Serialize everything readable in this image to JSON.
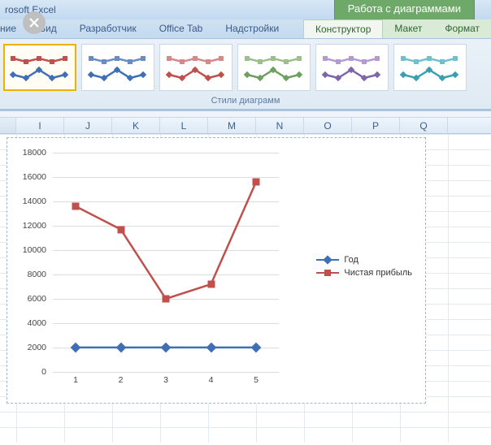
{
  "app": {
    "title": "rosoft Excel",
    "context_title": "Работа с диаграммами"
  },
  "tabs": {
    "partial_left": "ние",
    "items": [
      "Вид",
      "Разработчик",
      "Office Tab",
      "Надстройки"
    ],
    "context": [
      "Конструктор",
      "Макет",
      "Формат"
    ],
    "active_context_index": 0
  },
  "ribbon": {
    "group_label": "Стили диаграмм",
    "style_colors": [
      {
        "top": "#c0504d",
        "bot": "#3f6fb5"
      },
      {
        "top": "#6a8cc1",
        "bot": "#3f6fb5"
      },
      {
        "top": "#d48a88",
        "bot": "#c0504d"
      },
      {
        "top": "#9dbf8e",
        "bot": "#6ea160"
      },
      {
        "top": "#b39bcf",
        "bot": "#8066a8"
      },
      {
        "top": "#72c0cc",
        "bot": "#39a0b0"
      }
    ],
    "selected_style_index": 0
  },
  "columns": [
    "I",
    "J",
    "K",
    "L",
    "M",
    "N",
    "O",
    "P",
    "Q"
  ],
  "legend": {
    "series1": "Год",
    "series2": "Чистая прибыль"
  },
  "axis": {
    "y_ticks": [
      0,
      2000,
      4000,
      6000,
      8000,
      10000,
      12000,
      14000,
      16000,
      18000
    ],
    "x_ticks": [
      "1",
      "2",
      "3",
      "4",
      "5"
    ]
  },
  "chart_data": {
    "type": "line",
    "x": [
      1,
      2,
      3,
      4,
      5
    ],
    "series": [
      {
        "name": "Год",
        "values": [
          2007,
          2008,
          2009,
          2010,
          2011
        ],
        "color": "#3f6fb5",
        "marker": "diamond"
      },
      {
        "name": "Чистая прибыль",
        "values": [
          13600,
          11700,
          6000,
          7200,
          15600
        ],
        "color": "#c0504d",
        "marker": "square"
      }
    ],
    "title": "",
    "xlabel": "",
    "ylabel": "",
    "ylim": [
      0,
      18000
    ],
    "grid": true,
    "legend_position": "right"
  }
}
